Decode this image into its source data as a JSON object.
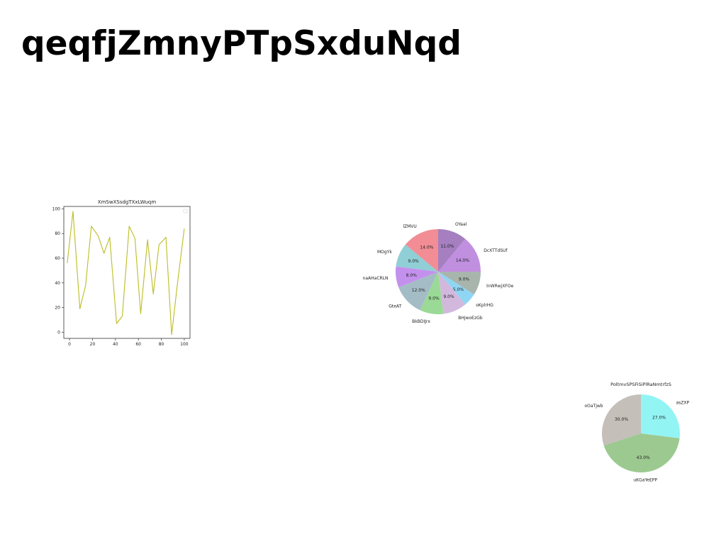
{
  "page": {
    "title": "qeqfjZmnyPTpSxduNqd"
  },
  "chart_data": [
    {
      "type": "line",
      "title": "XmSwXSsdgTXxLWuqm",
      "xlabel": "",
      "ylabel": "",
      "xlim": [
        -5,
        105
      ],
      "ylim": [
        -5,
        102
      ],
      "xticks": [
        0,
        20,
        40,
        60,
        80,
        100
      ],
      "yticks": [
        0,
        20,
        40,
        60,
        80,
        100
      ],
      "grid": false,
      "legend": "top-right (empty)",
      "series": [
        {
          "color": "#bcbd22",
          "x": [
            -2,
            3,
            9,
            14,
            19,
            25,
            30,
            35,
            41,
            46,
            52,
            57,
            62,
            68,
            73,
            78,
            84,
            89,
            94,
            100
          ],
          "y": [
            56,
            98,
            19,
            38,
            86,
            78,
            64,
            77,
            7,
            13,
            86,
            76,
            15,
            75,
            31,
            71,
            77,
            -2,
            39,
            84
          ]
        }
      ]
    },
    {
      "type": "pie",
      "title": "",
      "slices": [
        {
          "label": "OYaal",
          "value": 11.0,
          "pct_label": "11.0%",
          "color": "#a57fbf"
        },
        {
          "label": "DcXTTdSUf",
          "value": 14.0,
          "pct_label": "14.0%",
          "color": "#c08fe0"
        },
        {
          "label": "lnWRwjXFOe",
          "value": 9.0,
          "pct_label": "9.0%",
          "color": "#a8b5ad"
        },
        {
          "label": "oKplrHG",
          "value": 5.0,
          "pct_label": "5.0%",
          "color": "#8fd5f4"
        },
        {
          "label": "BHJwoEzGb",
          "value": 9.0,
          "pct_label": "9.0%",
          "color": "#d3b8de"
        },
        {
          "label": "BkBDIJrx",
          "value": 9.0,
          "pct_label": "9.0%",
          "color": "#9bd996"
        },
        {
          "label": "GteAT",
          "value": 12.0,
          "pct_label": "12.0%",
          "color": "#a4bcc5"
        },
        {
          "label": "naAHaCRLN",
          "value": 8.0,
          "pct_label": "8.0%",
          "color": "#c391ed"
        },
        {
          "label": "MOgYk",
          "value": 9.0,
          "pct_label": "9.0%",
          "color": "#90cfd6"
        },
        {
          "label": "lZMVU",
          "value": 14.0,
          "pct_label": "14.0%",
          "color": "#f28d95"
        }
      ]
    },
    {
      "type": "pie",
      "title": "PoltmvSPSFiSiPlRaNmtrfzS",
      "slices": [
        {
          "label": "asZXP",
          "value": 27.0,
          "pct_label": "27.0%",
          "color": "#93f4f4"
        },
        {
          "label": "uKGaYeEPP",
          "value": 43.0,
          "pct_label": "43.0%",
          "color": "#9cc990"
        },
        {
          "label": "oOaTjwb",
          "value": 30.0,
          "pct_label": "30.0%",
          "color": "#c4bfb9"
        }
      ]
    }
  ]
}
